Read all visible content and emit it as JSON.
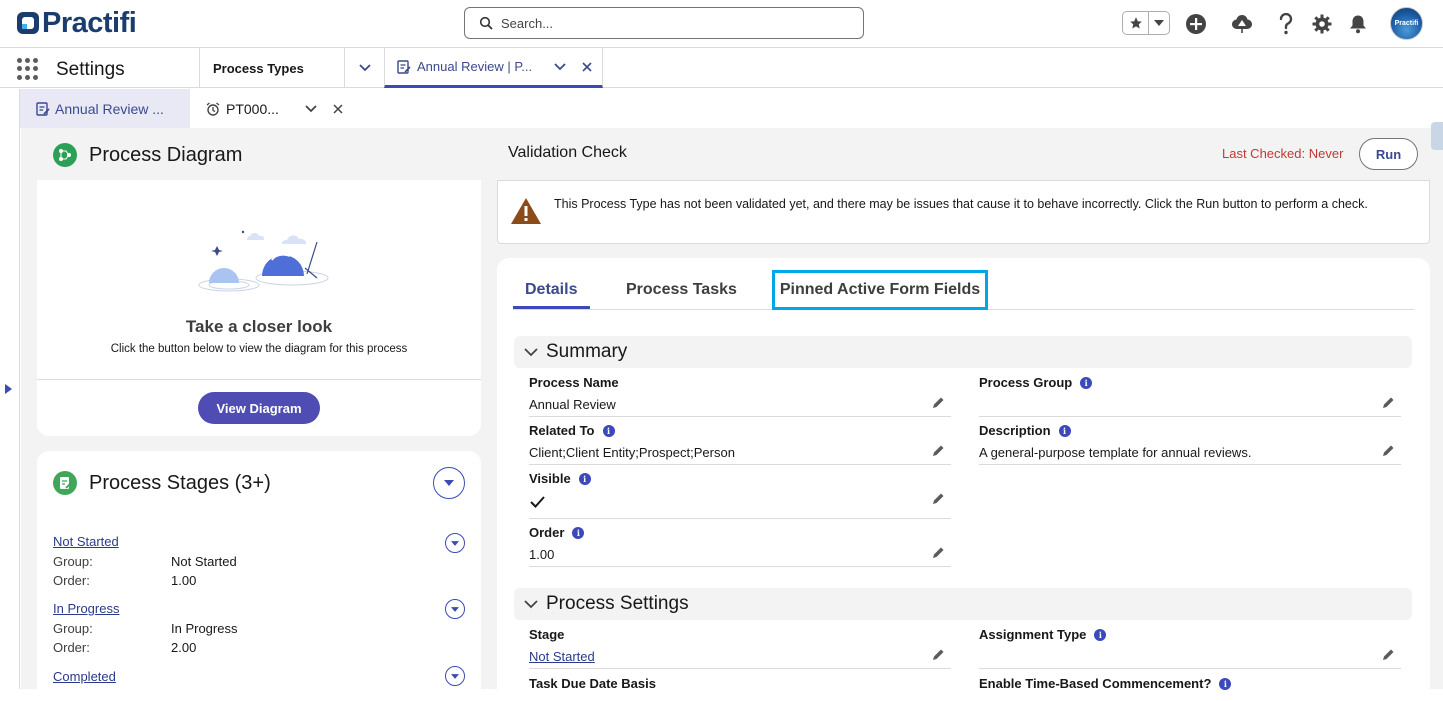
{
  "header": {
    "logo_text": "Practifi",
    "search_placeholder": "Search...",
    "avatar_text": "Practifi",
    "icons": [
      "star-icon",
      "chevron-down-icon",
      "add-icon",
      "trailhead-icon",
      "help-icon",
      "gear-icon",
      "bell-icon"
    ]
  },
  "nav": {
    "app_name": "Settings",
    "tabs": [
      {
        "label": "Process Types"
      },
      {
        "label": "Annual Review | P..."
      }
    ]
  },
  "subtabs": [
    {
      "label": "Annual Review ..."
    },
    {
      "label": "PT000..."
    }
  ],
  "diagram": {
    "title": "Process Diagram",
    "headline": "Take a closer look",
    "subtext": "Click the button below to view the diagram for this process",
    "button": "View Diagram"
  },
  "stages": {
    "title": "Process Stages (3+)",
    "group_label": "Group:",
    "order_label": "Order:",
    "items": [
      {
        "name": "Not Started",
        "group": "Not Started",
        "order": "1.00"
      },
      {
        "name": "In Progress",
        "group": "In Progress",
        "order": "2.00"
      },
      {
        "name": "Completed",
        "group": "",
        "order": ""
      }
    ]
  },
  "validation": {
    "title": "Validation Check",
    "last_checked": "Last Checked: Never",
    "run": "Run",
    "warning": "This Process Type has not been validated yet, and there may be issues that cause it to behave incorrectly. Click the Run button to perform a check."
  },
  "detail_tabs": [
    "Details",
    "Process Tasks",
    "Pinned Active Form Fields"
  ],
  "summary": {
    "title": "Summary",
    "process_name_label": "Process Name",
    "process_name": "Annual Review",
    "process_group_label": "Process Group",
    "process_group": "",
    "related_to_label": "Related To",
    "related_to": "Client;Client Entity;Prospect;Person",
    "description_label": "Description",
    "description": "A general-purpose template for annual reviews.",
    "visible_label": "Visible",
    "visible": true,
    "order_label": "Order",
    "order": "1.00"
  },
  "settings": {
    "title": "Process Settings",
    "stage_label": "Stage",
    "stage": "Not Started",
    "assignment_type_label": "Assignment Type",
    "assignment_type": "",
    "task_due_label": "Task Due Date Basis",
    "time_based_label": "Enable Time-Based Commencement?"
  },
  "colors": {
    "brand": "#4f4db3",
    "highlight_box": "#00a7e6",
    "warning_text": "#c23934",
    "link": "#2a3a8c"
  }
}
